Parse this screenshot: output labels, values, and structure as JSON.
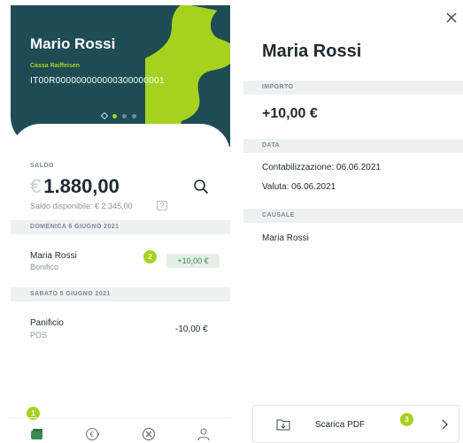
{
  "card": {
    "holder": "Mario Rossi",
    "bank": "Cassa Raiffeisen",
    "iban": "IT00R000000000000300000001",
    "page_dots": 4,
    "active_dot": 1
  },
  "balance": {
    "label": "SALDO",
    "currency": "€",
    "amount": "1.880,00",
    "available": "Saldo disponibile: € 2.345,00",
    "help": "?"
  },
  "transactions": [
    {
      "date_header": "DOMENICA 6 GIUGNO 2021",
      "title": "Maria Rossi",
      "type": "Bonifico",
      "amount": "+10,00 €"
    },
    {
      "date_header": "SABATO 5 GIUGNO 2021",
      "title": "Panificio",
      "type": "POS",
      "amount": "-10,00 €"
    }
  ],
  "badges": {
    "nav": "1",
    "transaction": "2",
    "pdf": "3"
  },
  "nav": [
    "wallet-icon",
    "euro-exchange-icon",
    "cancel-circle-icon",
    "user-icon"
  ],
  "detail": {
    "name": "Maria Rossi",
    "importo_label": "IMPORTO",
    "importo": "+10,00 €",
    "data_label": "DATA",
    "contabilizzazione": "Contabilizzazione: 06.06.2021",
    "valuta": "Valuta: 06.06.2021",
    "causale_label": "CAUSALE",
    "causale": "Maria Rossi",
    "pdf_label": "Scarica PDF"
  },
  "colors": {
    "card_bg": "#1d4c55",
    "accent": "#a6d21f",
    "positive": "#3b8a4e",
    "section_bg": "#eef1f2"
  }
}
